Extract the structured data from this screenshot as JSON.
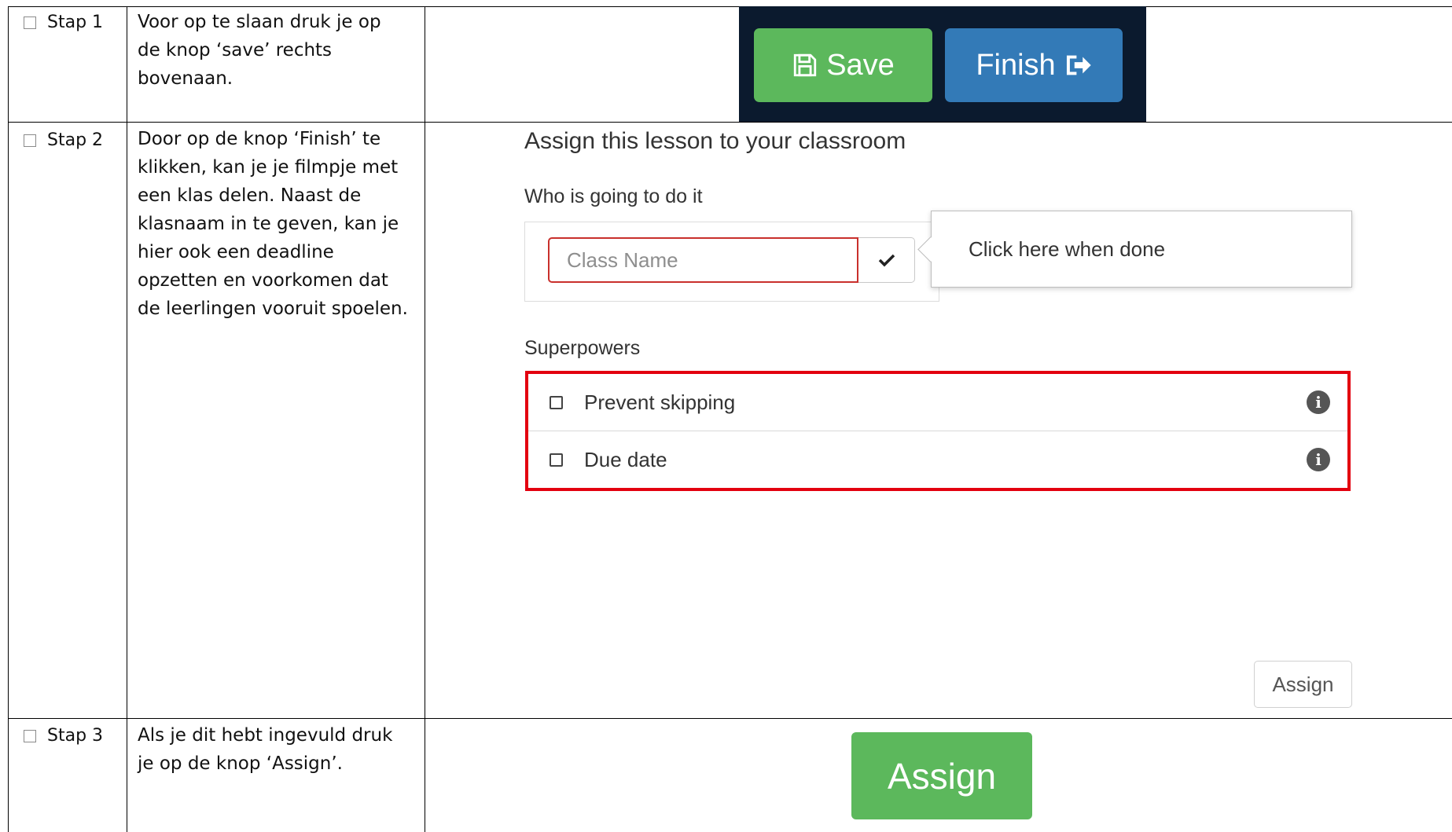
{
  "steps": [
    {
      "label": "Stap 1",
      "description": "Voor op te slaan druk je op de knop ‘save’ rechts bovenaan."
    },
    {
      "label": "Stap 2",
      "description": "Door op de knop ‘Finish’ te klikken, kan je je filmpje met een klas delen. Naast de klasnaam in te geven, kan je hier ook een deadline opzetten en voorkomen dat de leerlingen vooruit spoelen."
    },
    {
      "label": "Stap 3",
      "description": "Als je dit hebt ingevuld druk je op de knop ‘Assign’."
    }
  ],
  "toolbar": {
    "save_label": "Save",
    "finish_label": "Finish",
    "panel_color": "#0b1a2e",
    "save_color": "#5cb85c",
    "finish_color": "#337ab7"
  },
  "assign_dialog": {
    "title": "Assign this lesson to your classroom",
    "who_label": "Who is going to do it",
    "class_input_placeholder": "Class Name",
    "confirm_icon": "check-icon",
    "popover_text": "Click here when done",
    "superpowers_label": "Superpowers",
    "superpowers": [
      {
        "label": "Prevent skipping",
        "checked": false,
        "icon": "info-icon"
      },
      {
        "label": "Due date",
        "checked": false,
        "icon": "info-icon"
      }
    ],
    "highlight_color": "#e3000f",
    "assign_button_label": "Assign"
  },
  "final_assign": {
    "label": "Assign",
    "color": "#5cb85c"
  }
}
